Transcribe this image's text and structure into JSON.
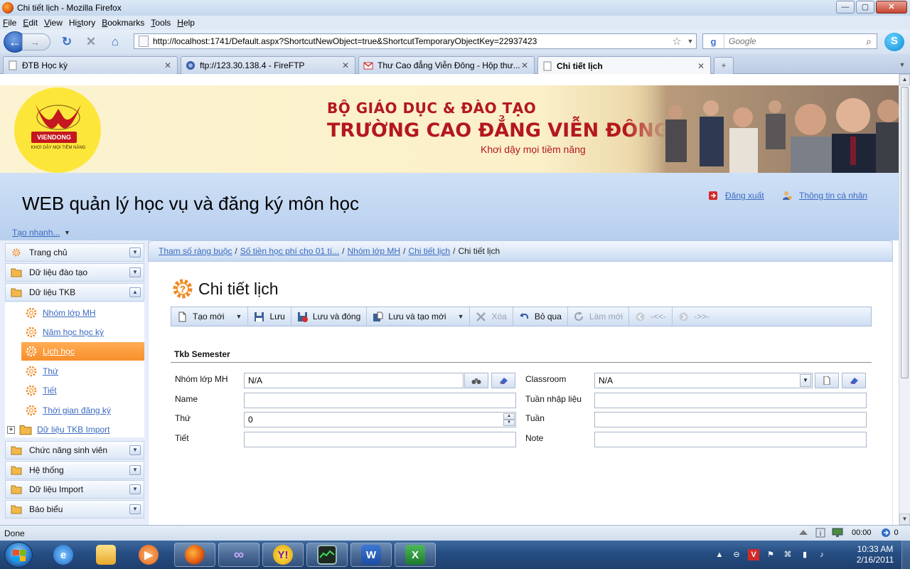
{
  "window": {
    "title": "Chi tiết lịch - Mozilla Firefox",
    "controls": {
      "minimize": "—",
      "maximize": "▢",
      "close": "✕"
    }
  },
  "menubar": {
    "items": [
      {
        "label": "File",
        "accel": "F"
      },
      {
        "label": "Edit",
        "accel": "E"
      },
      {
        "label": "View",
        "accel": "V"
      },
      {
        "label": "History",
        "accel": "s"
      },
      {
        "label": "Bookmarks",
        "accel": "B"
      },
      {
        "label": "Tools",
        "accel": "T"
      },
      {
        "label": "Help",
        "accel": "H"
      }
    ]
  },
  "navbar": {
    "url": "http://localhost:1741/Default.aspx?ShortcutNewObject=true&ShortcutTemporaryObjectKey=22937423",
    "search_placeholder": "Google",
    "search_engine_letter": "g"
  },
  "tabs": [
    {
      "label": "ĐTB Học kỳ",
      "active": false
    },
    {
      "label": "ftp://123.30.138.4 - FireFTP",
      "active": false
    },
    {
      "label": "Thư Cao đẳng Viễn Đông - Hộp thư...",
      "active": false
    },
    {
      "label": "Chi tiết lịch",
      "active": true
    }
  ],
  "new_tab": "+",
  "banner": {
    "logo_tag": "VIENDONG",
    "logo_slogan": "KHƠI DẬY MỌI TIỀM NĂNG",
    "line1": "BỘ GIÁO DỤC & ĐÀO TẠO",
    "line2": "TRƯỜNG CAO ĐẲNG VIỄN ĐÔNG",
    "line3": "Khơi dậy mọi tiềm năng"
  },
  "header": {
    "app_title": "WEB quản lý học vụ và đăng ký môn học",
    "logout": "Đăng xuất",
    "profile": "Thông tin cá nhân",
    "quick_create": "Tạo nhanh..."
  },
  "sidebar": {
    "groups_top": [
      {
        "label": "Trang chủ"
      },
      {
        "label": "Dữ liệu đào tạo"
      },
      {
        "label": "Dữ liệu TKB"
      }
    ],
    "tkb_items": [
      {
        "label": "Nhóm lớp MH"
      },
      {
        "label": "Năm học học kỳ"
      },
      {
        "label": "Lịch học",
        "active": true
      },
      {
        "label": "Thứ"
      },
      {
        "label": "Tiết"
      },
      {
        "label": "Thời gian đăng ký"
      }
    ],
    "import_item": "Dữ liệu TKB Import",
    "groups_bottom": [
      {
        "label": "Chức năng sinh viên"
      },
      {
        "label": "Hệ thống"
      },
      {
        "label": "Dữ liệu Import"
      },
      {
        "label": "Báo biểu"
      }
    ]
  },
  "breadcrumb": {
    "items": [
      "Tham số ràng buộc",
      "Số tiền học phí cho 01 tí...",
      "Nhóm lớp MH",
      "Chi tiết lịch"
    ],
    "current": "Chi tiết lịch",
    "separator": "/"
  },
  "page": {
    "title": "Chi tiết lịch",
    "section": "Tkb Semester"
  },
  "toolbar": {
    "new": "Tạo mới",
    "save": "Lưu",
    "save_close": "Lưu và đóng",
    "save_new": "Lưu và tạo mới",
    "delete": "Xóa",
    "cancel": "Bỏ qua",
    "refresh": "Làm mới",
    "prev": "-<<-",
    "next": "->>-"
  },
  "form": {
    "left": {
      "nhom_lop_label": "Nhóm lớp MH",
      "nhom_lop_value": "N/A",
      "name_label": "Name",
      "name_value": "",
      "thu_label": "Thứ",
      "thu_value": "0",
      "tiet_label": "Tiết",
      "tiet_value": ""
    },
    "right": {
      "classroom_label": "Classroom",
      "classroom_value": "N/A",
      "tuan_nhap_label": "Tuần nhập liệu",
      "tuan_nhap_value": "",
      "tuan_label": "Tuần",
      "tuan_value": "",
      "note_label": "Note",
      "note_value": ""
    }
  },
  "statusbar": {
    "text": "Done",
    "timer": "00:00",
    "count": "0"
  },
  "taskbar": {
    "time": "10:33 AM",
    "date": "2/16/2011"
  }
}
